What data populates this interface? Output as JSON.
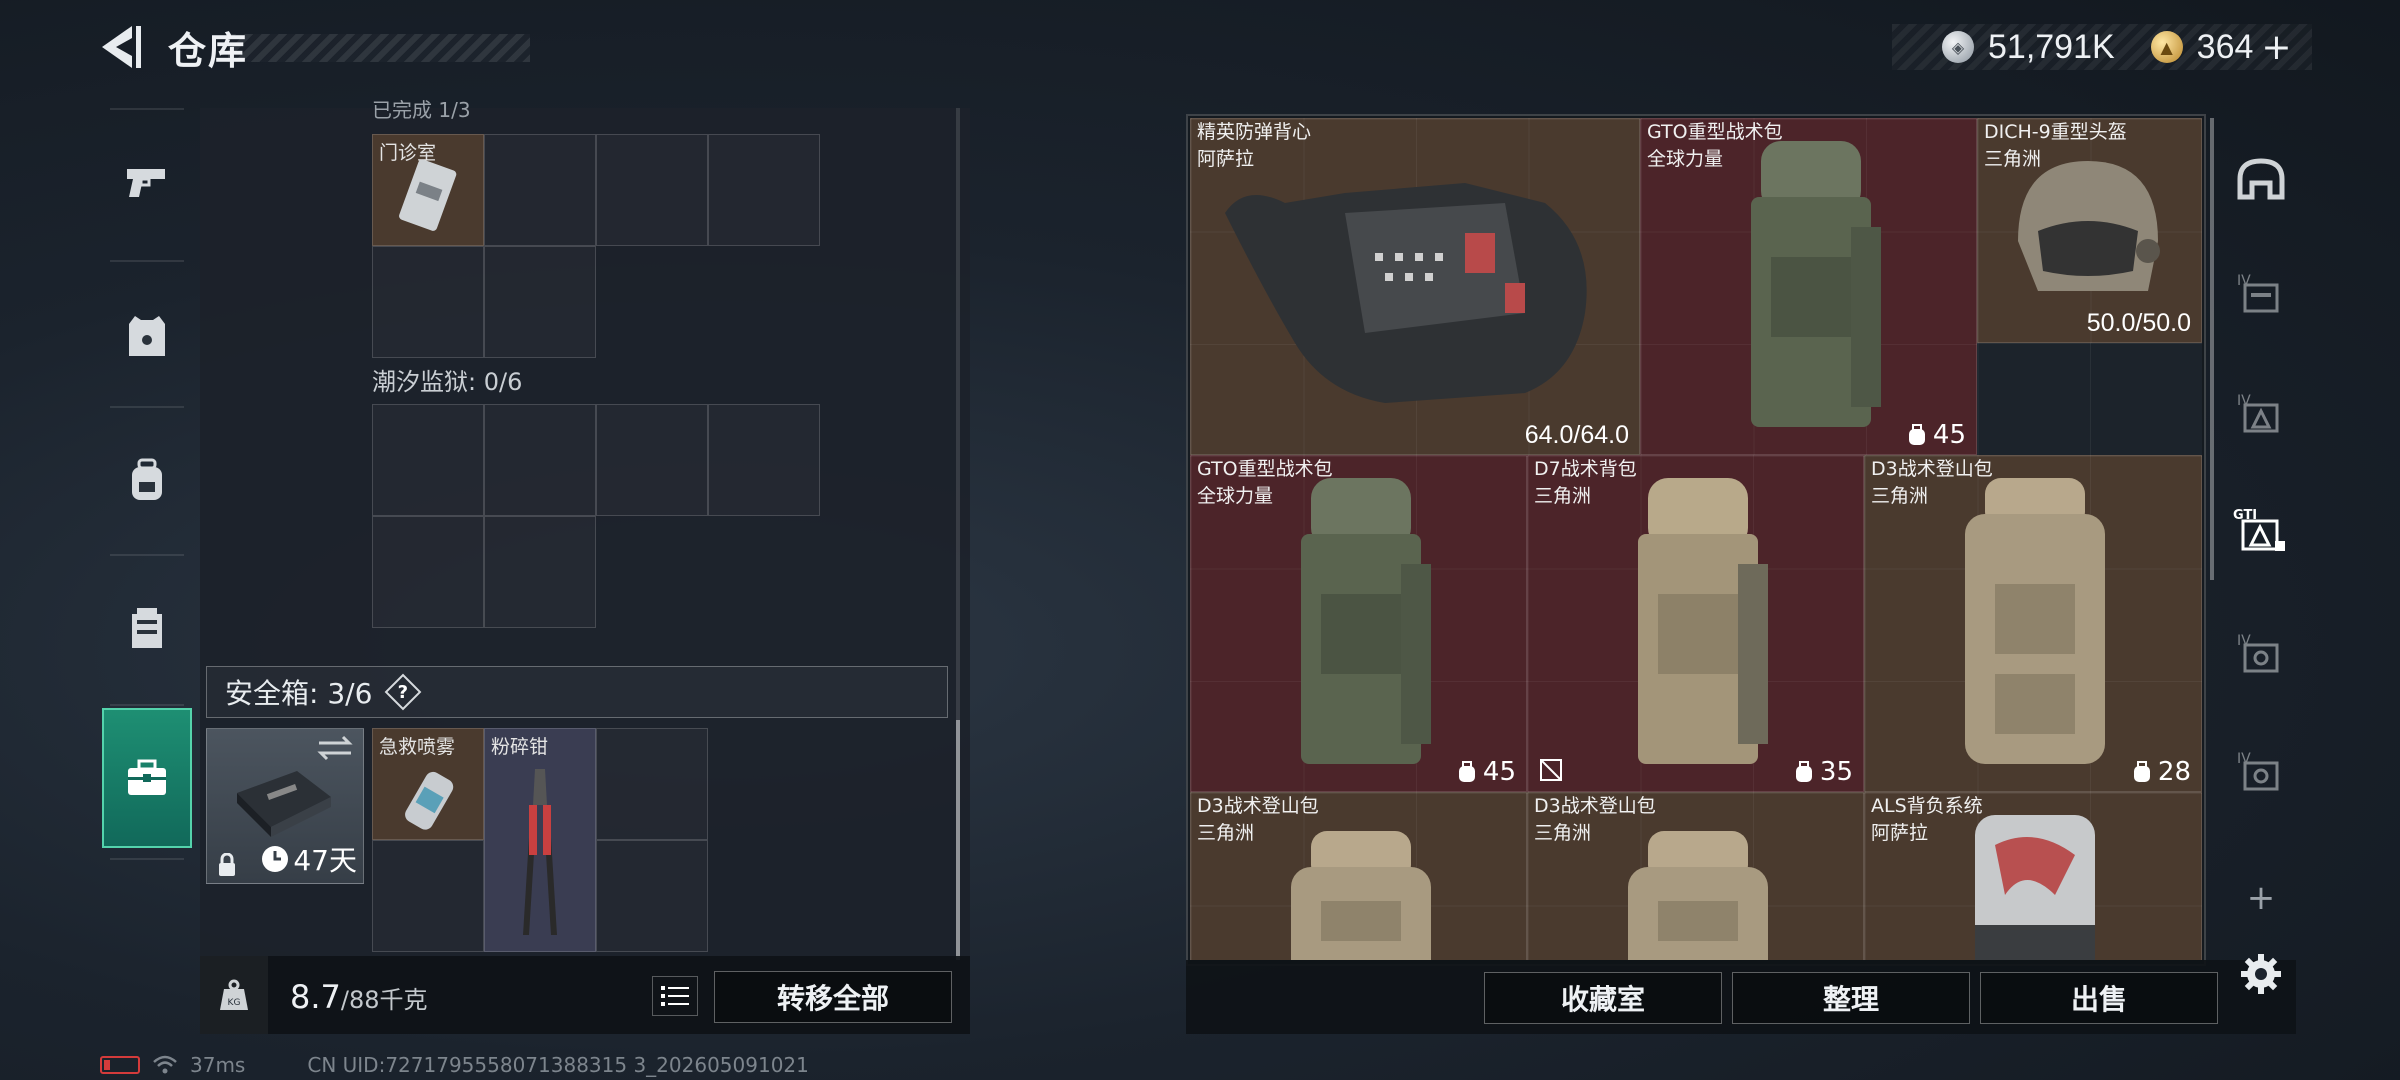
{
  "header": {
    "title": "仓库",
    "currency": [
      {
        "icon": "silver-coin-icon",
        "value": "51,791K"
      },
      {
        "icon": "gold-coin-icon",
        "value": "364"
      }
    ],
    "plus_label": "+"
  },
  "left_nav": {
    "items": [
      {
        "icon": "pistol-icon"
      },
      {
        "icon": "armor-vest-icon"
      },
      {
        "icon": "backpack-icon"
      },
      {
        "icon": "chest-rig-icon"
      },
      {
        "icon": "briefcase-icon",
        "active": true
      }
    ]
  },
  "storage": {
    "top_section_label": "已完成 1/3",
    "clinic_item": "门诊室",
    "prison_label": "潮汐监狱: 0/6",
    "safe_title": "安全箱: 3/6",
    "help_label": "?",
    "safe_days": "47天",
    "safe_items": [
      {
        "name": "急救喷雾"
      },
      {
        "name": "粉碎钳"
      }
    ]
  },
  "left_bottom": {
    "weight_current": "8.7",
    "weight_max": "/88千克",
    "transfer_all": "转移全部"
  },
  "items": [
    {
      "name": "精英防弹背心",
      "brand": "阿萨拉",
      "durability": "64.0/64.0",
      "color": "brown"
    },
    {
      "name": "GTO重型战术包",
      "brand": "全球力量",
      "capacity": "45",
      "color": "red"
    },
    {
      "name": "DICH-9重型头盔",
      "brand": "三角洲",
      "durability": "50.0/50.0",
      "color": "brown"
    },
    {
      "name": "GTO重型战术包",
      "brand": "全球力量",
      "capacity": "45",
      "color": "red"
    },
    {
      "name": "D7战术背包",
      "brand": "三角洲",
      "capacity": "35",
      "color": "red"
    },
    {
      "name": "D3战术登山包",
      "brand": "三角洲",
      "capacity": "28",
      "color": "brown"
    },
    {
      "name": "D3战术登山包",
      "brand": "三角洲",
      "color": "brown"
    },
    {
      "name": "D3战术登山包",
      "brand": "三角洲",
      "color": "brown"
    },
    {
      "name": "ALS背负系统",
      "brand": "阿萨拉",
      "color": "brown"
    }
  ],
  "right_bottom": {
    "collection": "收藏室",
    "sort": "整理",
    "sell": "出售"
  },
  "right_nav": {
    "items": [
      {
        "icon": "helmet-filter-icon"
      },
      {
        "icon": "storage-iv-icon-1"
      },
      {
        "icon": "storage-iv-icon-2"
      },
      {
        "icon": "storage-gti-icon"
      },
      {
        "icon": "storage-iv-icon-3"
      },
      {
        "icon": "storage-iv-icon-4"
      }
    ],
    "add_label": "+"
  },
  "status": {
    "ping": "37ms",
    "uid": "CN UID:7271795558071388315 3_202605091021"
  },
  "colors": {
    "accent_green": "#1e8f73",
    "card_brown": "#4a3a2e",
    "card_red": "#4c2429"
  }
}
